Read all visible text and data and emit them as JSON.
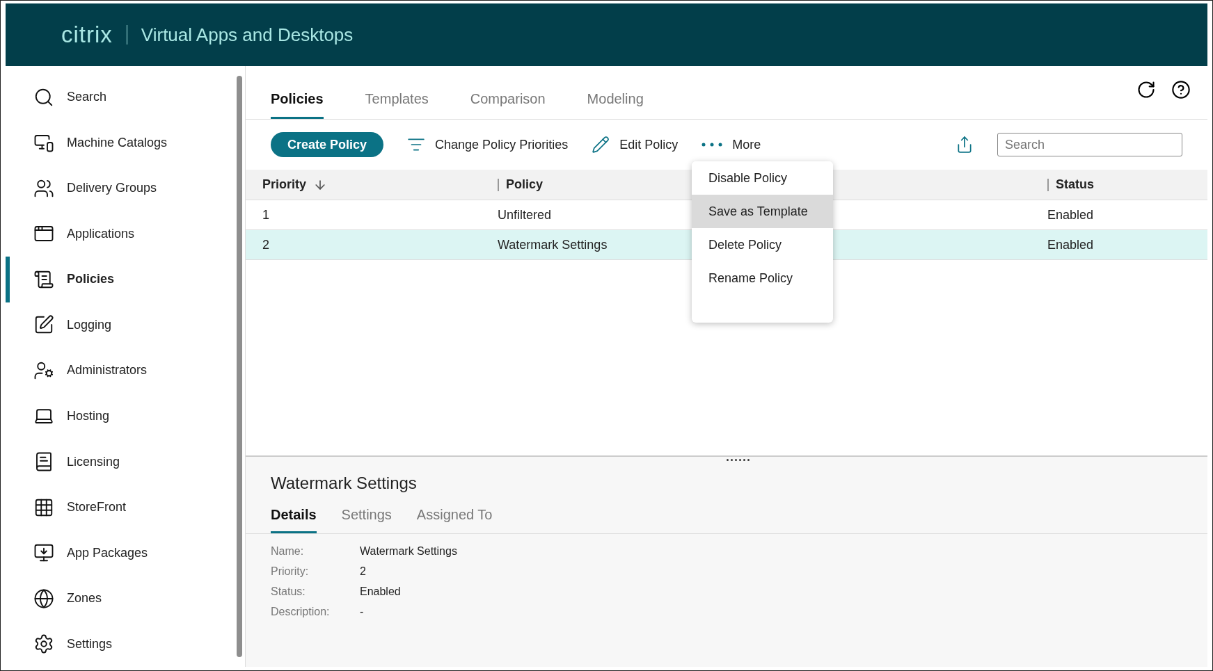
{
  "header": {
    "logo": "citrix",
    "title": "Virtual Apps and Desktops"
  },
  "sidebar": {
    "items": [
      {
        "label": "Search",
        "selected": false
      },
      {
        "label": "Machine Catalogs",
        "selected": false
      },
      {
        "label": "Delivery Groups",
        "selected": false
      },
      {
        "label": "Applications",
        "selected": false
      },
      {
        "label": "Policies",
        "selected": true
      },
      {
        "label": "Logging",
        "selected": false
      },
      {
        "label": "Administrators",
        "selected": false
      },
      {
        "label": "Hosting",
        "selected": false
      },
      {
        "label": "Licensing",
        "selected": false
      },
      {
        "label": "StoreFront",
        "selected": false
      },
      {
        "label": "App Packages",
        "selected": false
      },
      {
        "label": "Zones",
        "selected": false
      },
      {
        "label": "Settings",
        "selected": false
      }
    ]
  },
  "tabs": [
    {
      "label": "Policies",
      "selected": true
    },
    {
      "label": "Templates",
      "selected": false
    },
    {
      "label": "Comparison",
      "selected": false
    },
    {
      "label": "Modeling",
      "selected": false
    }
  ],
  "toolbar": {
    "primary": "Create Policy",
    "actions": [
      "Change Policy Priorities",
      "Edit Policy",
      "More"
    ],
    "search": {
      "placeholder": "Search"
    }
  },
  "menu": [
    {
      "label": "Disable Policy",
      "highlighted": false
    },
    {
      "label": "Save as Template",
      "highlighted": true
    },
    {
      "label": "Delete Policy",
      "highlighted": false
    },
    {
      "label": "Rename Policy",
      "highlighted": false
    }
  ],
  "table": {
    "columns": [
      "Priority",
      "Policy",
      "Status"
    ],
    "rows": [
      {
        "cells": [
          "1",
          "Unfiltered",
          "Enabled"
        ],
        "selected": false
      },
      {
        "cells": [
          "2",
          "Watermark Settings",
          "Enabled"
        ],
        "selected": true
      }
    ]
  },
  "details": {
    "title": "Watermark Settings",
    "tabs": [
      {
        "label": "Details",
        "selected": true
      },
      {
        "label": "Settings",
        "selected": false
      },
      {
        "label": "Assigned To",
        "selected": false
      }
    ],
    "fields": [
      {
        "label": "Name:",
        "value": "Watermark Settings"
      },
      {
        "label": "Priority:",
        "value": "2"
      },
      {
        "label": "Status:",
        "value": "Enabled"
      },
      {
        "label": "Description:",
        "value": "-"
      }
    ]
  }
}
